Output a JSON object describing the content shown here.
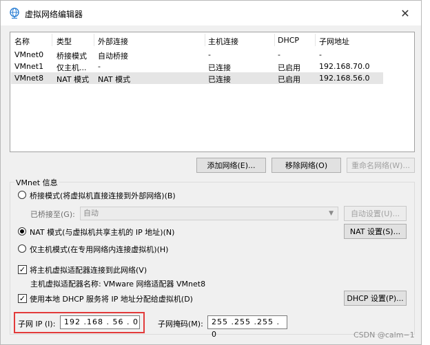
{
  "window": {
    "title": "虚拟网络编辑器",
    "close_glyph": "✕"
  },
  "table": {
    "headers": [
      "名称",
      "类型",
      "外部连接",
      "主机连接",
      "DHCP",
      "子网地址"
    ],
    "rows": [
      [
        "VMnet0",
        "桥接模式",
        "自动桥接",
        "-",
        "-",
        "-"
      ],
      [
        "VMnet1",
        "仅主机...",
        "-",
        "已连接",
        "已启用",
        "192.168.70.0"
      ],
      [
        "VMnet8",
        "NAT 模式",
        "NAT 模式",
        "已连接",
        "已启用",
        "192.168.56.0"
      ]
    ],
    "selected_row": 2
  },
  "buttons": {
    "add_network": "添加网络(E)...",
    "remove_network": "移除网络(O)",
    "rename_network": "重命名网络(W)..."
  },
  "vmnet_info": {
    "title": "VMnet 信息",
    "bridged_label": "桥接模式(将虚拟机直接连接到外部网络)(B)",
    "bridged_to_label": "已桥接至(G):",
    "bridged_to_value": "自动",
    "auto_settings": "自动设置(U)...",
    "nat_label": "NAT 模式(与虚拟机共享主机的 IP 地址)(N)",
    "nat_settings": "NAT 设置(S)...",
    "hostonly_label": "仅主机模式(在专用网络内连接虚拟机)(H)",
    "connect_adapter_label": "将主机虚拟适配器连接到此网络(V)",
    "adapter_name_label": "主机虚拟适配器名称: VMware 网络适配器 VMnet8",
    "dhcp_label": "使用本地 DHCP 服务将 IP 地址分配给虚拟机(D)",
    "dhcp_settings": "DHCP 设置(P)...",
    "subnet_ip_label": "子网 IP (I):",
    "subnet_ip_value": "192 .168 . 56 . 0",
    "subnet_mask_label": "子网掩码(M):",
    "subnet_mask_value": "255 .255 .255 . 0",
    "selected_mode": "nat",
    "connect_adapter_checked": true,
    "dhcp_checked": true
  },
  "watermark": "CSDN @calm−1",
  "colors": {
    "highlight": "#e23a3a",
    "selection": "#e5e5e5",
    "globe_icon": "#2a7fd4"
  }
}
